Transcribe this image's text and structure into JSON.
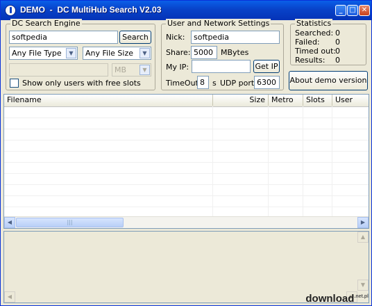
{
  "window": {
    "title": "DEMO  -  DC MultiHub Search V2.03"
  },
  "search_engine": {
    "group_title": "DC Search Engine",
    "query": "softpedia",
    "search_label": "Search",
    "file_type": "Any File Type",
    "file_size": "Any File Size",
    "size_value": "",
    "size_unit": "MB",
    "free_slots_label": "Show only users with free slots"
  },
  "network": {
    "group_title": "User and Network Settings",
    "nick_label": "Nick:",
    "nick_value": "softpedia",
    "share_label": "Share:",
    "share_value": "5000",
    "share_unit": "MBytes",
    "myip_label": "My IP:",
    "myip_value": "",
    "getip_label": "Get IP",
    "timeout_label": "TimeOut:",
    "timeout_value": "8",
    "timeout_unit": "s",
    "udp_label": "UDP port:",
    "udp_value": "6300"
  },
  "stats": {
    "group_title": "Statistics",
    "rows": [
      {
        "label": "Searched:",
        "value": "0"
      },
      {
        "label": "Failed:",
        "value": "0"
      },
      {
        "label": "Timed out:",
        "value": "0"
      },
      {
        "label": "Results:",
        "value": "0"
      }
    ],
    "about_label": "About demo version"
  },
  "results": {
    "columns": [
      "Filename",
      "Size",
      "Metro",
      "Slots",
      "User"
    ],
    "rows": []
  },
  "log": {
    "text": ""
  },
  "footer_watermark": {
    "text": "download",
    "suffix": ".net.pl"
  }
}
